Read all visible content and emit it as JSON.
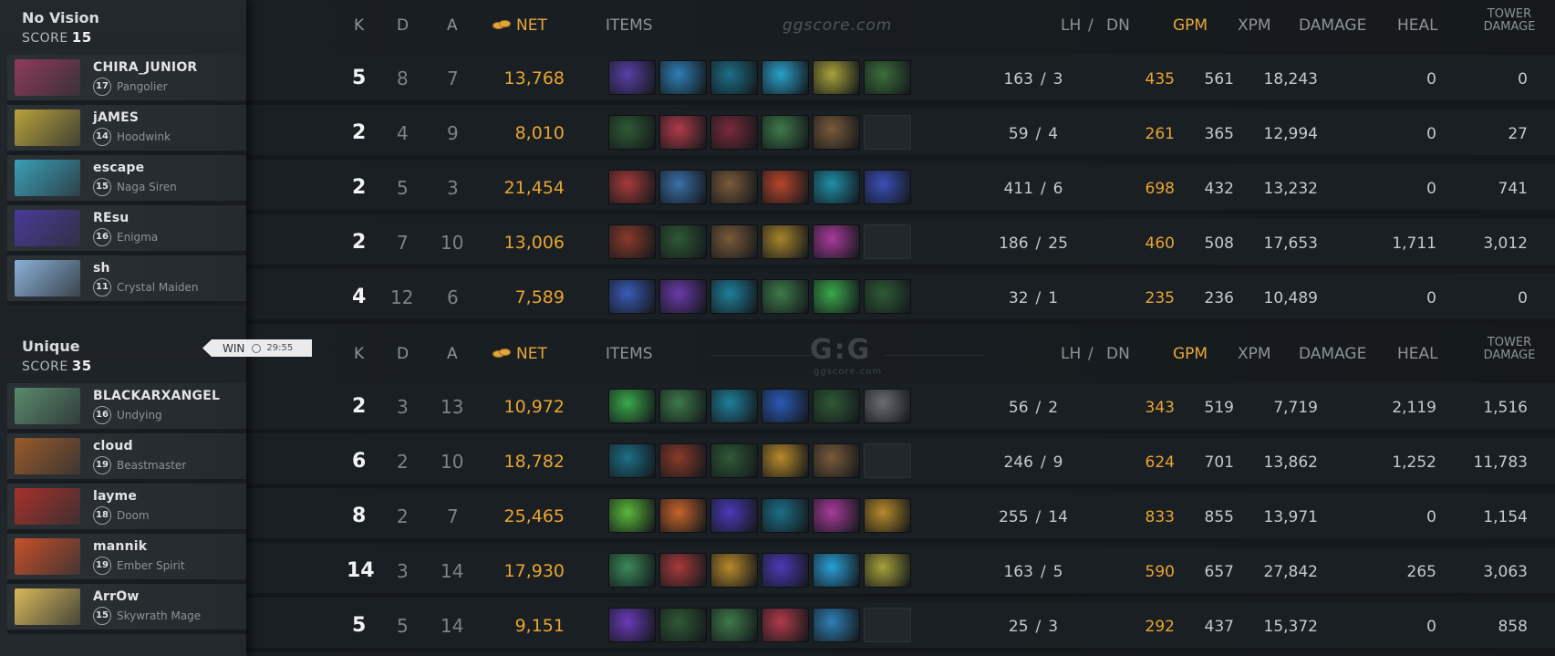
{
  "columns": {
    "k": "K",
    "d": "D",
    "a": "A",
    "net": "NET",
    "items": "ITEMS",
    "lh": "LH",
    "slash": "/",
    "dn": "DN",
    "gpm": "GPM",
    "xpm": "XPM",
    "damage": "DAMAGE",
    "heal": "HEAL",
    "tower_line1": "TOWER",
    "tower_line2": "DAMAGE"
  },
  "watermark": "ggscore.com",
  "logo": {
    "mark": "G:G",
    "sub": "ggscore.com"
  },
  "win_badge": {
    "label": "WIN",
    "time": "29:55"
  },
  "teams": [
    {
      "name": "No Vision",
      "score_label": "SCORE",
      "score": "15",
      "players": [
        {
          "name": "CHIRA_JUNIOR",
          "level": "17",
          "hero": "Pangolier",
          "portrait": "#8e3b5a",
          "k": "5",
          "d": "8",
          "a": "7",
          "net": "13,768",
          "lh": "163",
          "dn": "3",
          "gpm": "435",
          "xpm": "561",
          "damage": "18,243",
          "heal": "0",
          "tower": "0",
          "items": [
            "#5a3fa8",
            "#2f7fb5",
            "#1c6f87",
            "#2aa0c9",
            "#a8a13a",
            "#3d6f3a"
          ]
        },
        {
          "name": "jAMES",
          "level": "14",
          "hero": "Hoodwink",
          "portrait": "#b8a23a",
          "k": "2",
          "d": "4",
          "a": "9",
          "net": "8,010",
          "lh": "59",
          "dn": "4",
          "gpm": "261",
          "xpm": "365",
          "damage": "12,994",
          "heal": "0",
          "tower": "27",
          "items": [
            "#2f5a35",
            "#b23a4a",
            "#7a2a3a",
            "#3e7a4a",
            "#7a5a3a",
            ""
          ]
        },
        {
          "name": "escape",
          "level": "15",
          "hero": "Naga Siren",
          "portrait": "#3aa0b8",
          "k": "2",
          "d": "5",
          "a": "3",
          "net": "21,454",
          "lh": "411",
          "dn": "6",
          "gpm": "698",
          "xpm": "432",
          "damage": "13,232",
          "heal": "0",
          "tower": "741",
          "items": [
            "#a83a3a",
            "#3a6fa8",
            "#7a5a3a",
            "#b8452a",
            "#1e8fa8",
            "#3a4fb8"
          ]
        },
        {
          "name": "REsu",
          "level": "16",
          "hero": "Enigma",
          "portrait": "#4a3a9a",
          "k": "2",
          "d": "7",
          "a": "10",
          "net": "13,006",
          "lh": "186",
          "dn": "25",
          "gpm": "460",
          "xpm": "508",
          "damage": "17,653",
          "heal": "1,711",
          "tower": "3,012",
          "items": [
            "#8a3a2a",
            "#2f5a35",
            "#7a5a3a",
            "#a8832a",
            "#a83a9a",
            ""
          ]
        },
        {
          "name": "sh",
          "level": "11",
          "hero": "Crystal Maiden",
          "portrait": "#8ab0d8",
          "k": "4",
          "d": "12",
          "a": "6",
          "net": "7,589",
          "lh": "32",
          "dn": "1",
          "gpm": "235",
          "xpm": "236",
          "damage": "10,489",
          "heal": "0",
          "tower": "0",
          "items": [
            "#3a5ab8",
            "#6a3aa8",
            "#1e7f9a",
            "#3e7a4a",
            "#3aa84a",
            "#2f5a35"
          ]
        }
      ]
    },
    {
      "name": "Unique",
      "score_label": "SCORE",
      "score": "35",
      "players": [
        {
          "name": "BLACKARXANGEL",
          "level": "16",
          "hero": "Undying",
          "portrait": "#5a8a6a",
          "k": "2",
          "d": "3",
          "a": "13",
          "net": "10,972",
          "lh": "56",
          "dn": "2",
          "gpm": "343",
          "xpm": "519",
          "damage": "7,719",
          "heal": "2,119",
          "tower": "1,516",
          "items": [
            "#3aa84a",
            "#3e7a4a",
            "#1e7f9a",
            "#2a5ab8",
            "#2f5a35",
            "#6a6e72"
          ]
        },
        {
          "name": "cloud",
          "level": "19",
          "hero": "Beastmaster",
          "portrait": "#9a5a2a",
          "k": "6",
          "d": "2",
          "a": "10",
          "net": "18,782",
          "lh": "246",
          "dn": "9",
          "gpm": "624",
          "xpm": "701",
          "damage": "13,862",
          "heal": "1,252",
          "tower": "11,783",
          "items": [
            "#1c6f87",
            "#8a3a2a",
            "#2f5a35",
            "#b88a2a",
            "#7a5a3a",
            ""
          ]
        },
        {
          "name": "layme",
          "level": "18",
          "hero": "Doom",
          "portrait": "#a8302a",
          "k": "8",
          "d": "2",
          "a": "7",
          "net": "25,465",
          "lh": "255",
          "dn": "14",
          "gpm": "833",
          "xpm": "855",
          "damage": "13,971",
          "heal": "0",
          "tower": "1,154",
          "items": [
            "#5ab83a",
            "#c8642a",
            "#4a3ab8",
            "#1c6f87",
            "#a83a9a",
            "#b88a2a"
          ]
        },
        {
          "name": "mannik",
          "level": "19",
          "hero": "Ember Spirit",
          "portrait": "#c8502a",
          "k": "14",
          "d": "3",
          "a": "14",
          "net": "17,930",
          "lh": "163",
          "dn": "5",
          "gpm": "590",
          "xpm": "657",
          "damage": "27,842",
          "heal": "265",
          "tower": "3,063",
          "items": [
            "#3a8a5a",
            "#a83a3a",
            "#b88a2a",
            "#4a3ab8",
            "#2aa0d8",
            "#a8a13a"
          ]
        },
        {
          "name": "ArrOw",
          "level": "15",
          "hero": "Skywrath Mage",
          "portrait": "#d8b85a",
          "k": "5",
          "d": "5",
          "a": "14",
          "net": "9,151",
          "lh": "25",
          "dn": "3",
          "gpm": "292",
          "xpm": "437",
          "damage": "15,372",
          "heal": "0",
          "tower": "858",
          "items": [
            "#6a3ab8",
            "#2f5a35",
            "#3e7a4a",
            "#b23a4a",
            "#2f7fb5",
            ""
          ]
        }
      ]
    }
  ]
}
